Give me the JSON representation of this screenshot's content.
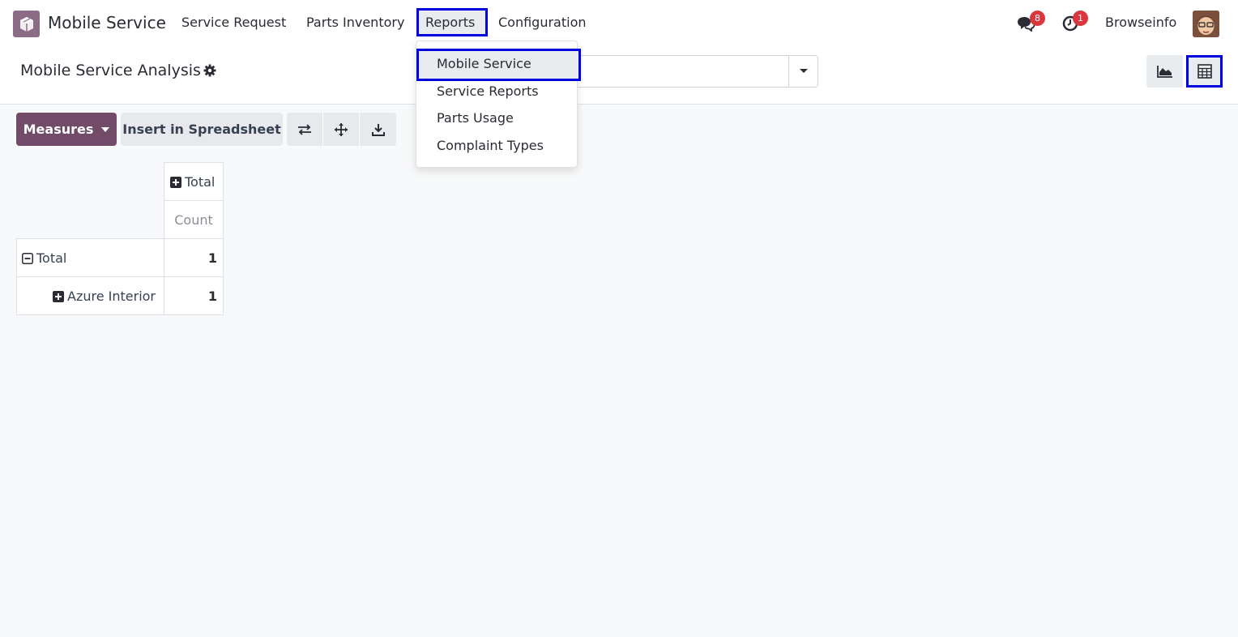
{
  "navbar": {
    "app_name": "Mobile Service",
    "menu": [
      "Service Request",
      "Parts Inventory",
      "Reports",
      "Configuration"
    ],
    "messages_badge": "8",
    "activities_badge": "1",
    "user_name": "Browseinfo"
  },
  "control_panel": {
    "title": "Mobile Service Analysis",
    "views": [
      "graph",
      "pivot"
    ],
    "active_view": "pivot"
  },
  "toolbar": {
    "measures_label": "Measures",
    "insert_label": "Insert in Spreadsheet"
  },
  "pivot": {
    "col_header": "Total",
    "measure": "Count",
    "rows": [
      {
        "label": "Total",
        "value": "1"
      },
      {
        "label": "Azure Interior",
        "value": "1"
      }
    ]
  },
  "reports_menu": {
    "items": [
      "Mobile Service",
      "Service Reports",
      "Parts Usage",
      "Complaint Types"
    ],
    "highlighted": "Mobile Service"
  },
  "colors": {
    "brand": "#714b67",
    "highlight_border": "#0000e0",
    "badge": "#d9363e"
  }
}
